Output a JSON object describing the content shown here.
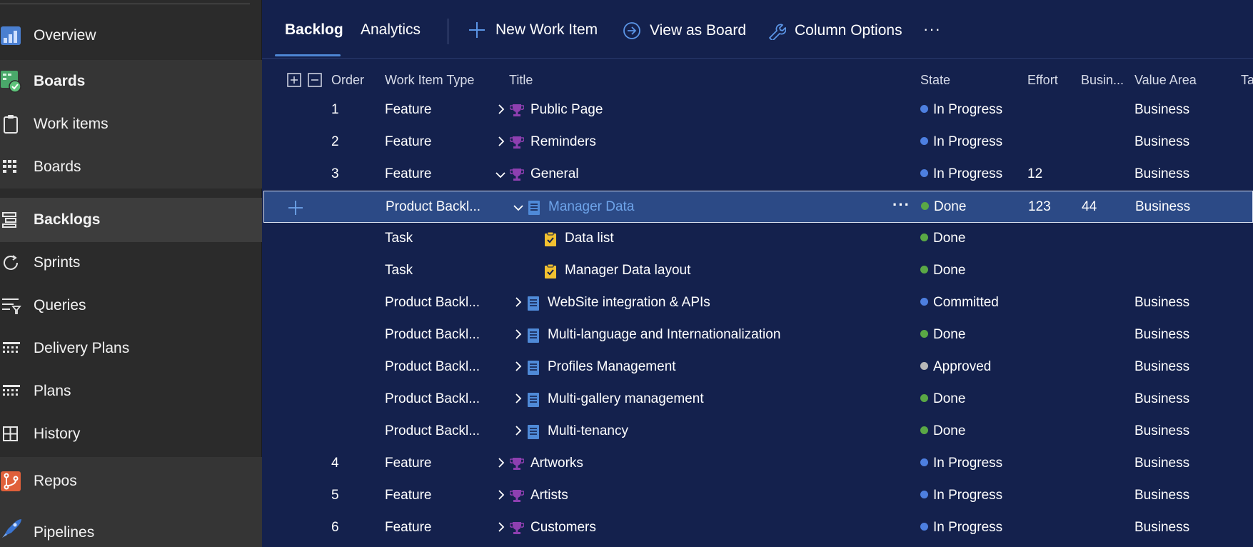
{
  "colors": {
    "background": "#14214d",
    "sidebar": "#2b2b2b",
    "accent": "#4e86d4",
    "state_in_progress": "#4d7fe0",
    "state_done": "#5aa845",
    "state_committed": "#4d7fe0",
    "state_approved": "#b8b8b8",
    "feature_icon": "#8e3fb0",
    "pbi_icon": "#4f8ad8",
    "task_icon": "#f2c130"
  },
  "sidebar": {
    "items": [
      {
        "label": "Overview",
        "icon": "overview-icon"
      },
      {
        "label": "Boards",
        "icon": "boards-hub-icon"
      },
      {
        "label": "Work items",
        "icon": "work-items-icon"
      },
      {
        "label": "Boards",
        "icon": "boards-icon"
      },
      {
        "label": "Backlogs",
        "icon": "backlogs-icon"
      },
      {
        "label": "Sprints",
        "icon": "sprints-icon"
      },
      {
        "label": "Queries",
        "icon": "queries-icon"
      },
      {
        "label": "Delivery Plans",
        "icon": "delivery-plans-icon"
      },
      {
        "label": "Plans",
        "icon": "plans-icon"
      },
      {
        "label": "History",
        "icon": "history-icon"
      },
      {
        "label": "Repos",
        "icon": "repos-icon"
      },
      {
        "label": "Pipelines",
        "icon": "pipelines-icon"
      }
    ]
  },
  "toolbar": {
    "tab_backlog": "Backlog",
    "tab_analytics": "Analytics",
    "new_work_item": "New Work Item",
    "view_as_board": "View as Board",
    "column_options": "Column Options",
    "more": "···"
  },
  "table": {
    "headers": {
      "order": "Order",
      "type": "Work Item Type",
      "title": "Title",
      "state": "State",
      "effort": "Effort",
      "business": "Busin...",
      "value_area": "Value Area",
      "tags": "Ta"
    },
    "rows": [
      {
        "order": "1",
        "type": "Feature",
        "title": "Public Page",
        "state": "In Progress",
        "effort": "",
        "business": "",
        "value_area": "Business",
        "kind": "feature",
        "expand": "collapsed"
      },
      {
        "order": "2",
        "type": "Feature",
        "title": "Reminders",
        "state": "In Progress",
        "effort": "",
        "business": "",
        "value_area": "Business",
        "kind": "feature",
        "expand": "collapsed"
      },
      {
        "order": "3",
        "type": "Feature",
        "title": "General",
        "state": "In Progress",
        "effort": "12",
        "business": "",
        "value_area": "Business",
        "kind": "feature",
        "expand": "expanded"
      },
      {
        "order": "",
        "type": "Product Backl...",
        "title": "Manager Data",
        "state": "Done",
        "effort": "123",
        "business": "44",
        "value_area": "Business",
        "kind": "pbi",
        "expand": "expanded",
        "selected": true
      },
      {
        "order": "",
        "type": "Task",
        "title": "Data list",
        "state": "Done",
        "effort": "",
        "business": "",
        "value_area": "",
        "kind": "task",
        "expand": "none"
      },
      {
        "order": "",
        "type": "Task",
        "title": "Manager Data layout",
        "state": "Done",
        "effort": "",
        "business": "",
        "value_area": "",
        "kind": "task",
        "expand": "none"
      },
      {
        "order": "",
        "type": "Product Backl...",
        "title": "WebSite integration & APIs",
        "state": "Committed",
        "effort": "",
        "business": "",
        "value_area": "Business",
        "kind": "pbi",
        "expand": "collapsed"
      },
      {
        "order": "",
        "type": "Product Backl...",
        "title": "Multi-language and Internationalization",
        "state": "Done",
        "effort": "",
        "business": "",
        "value_area": "Business",
        "kind": "pbi",
        "expand": "collapsed"
      },
      {
        "order": "",
        "type": "Product Backl...",
        "title": "Profiles Management",
        "state": "Approved",
        "effort": "",
        "business": "",
        "value_area": "Business",
        "kind": "pbi",
        "expand": "collapsed"
      },
      {
        "order": "",
        "type": "Product Backl...",
        "title": "Multi-gallery management",
        "state": "Done",
        "effort": "",
        "business": "",
        "value_area": "Business",
        "kind": "pbi",
        "expand": "collapsed"
      },
      {
        "order": "",
        "type": "Product Backl...",
        "title": "Multi-tenancy",
        "state": "Done",
        "effort": "",
        "business": "",
        "value_area": "Business",
        "kind": "pbi",
        "expand": "collapsed"
      },
      {
        "order": "4",
        "type": "Feature",
        "title": "Artworks",
        "state": "In Progress",
        "effort": "",
        "business": "",
        "value_area": "Business",
        "kind": "feature",
        "expand": "collapsed"
      },
      {
        "order": "5",
        "type": "Feature",
        "title": "Artists",
        "state": "In Progress",
        "effort": "",
        "business": "",
        "value_area": "Business",
        "kind": "feature",
        "expand": "collapsed"
      },
      {
        "order": "6",
        "type": "Feature",
        "title": "Customers",
        "state": "In Progress",
        "effort": "",
        "business": "",
        "value_area": "Business",
        "kind": "feature",
        "expand": "collapsed"
      }
    ]
  }
}
